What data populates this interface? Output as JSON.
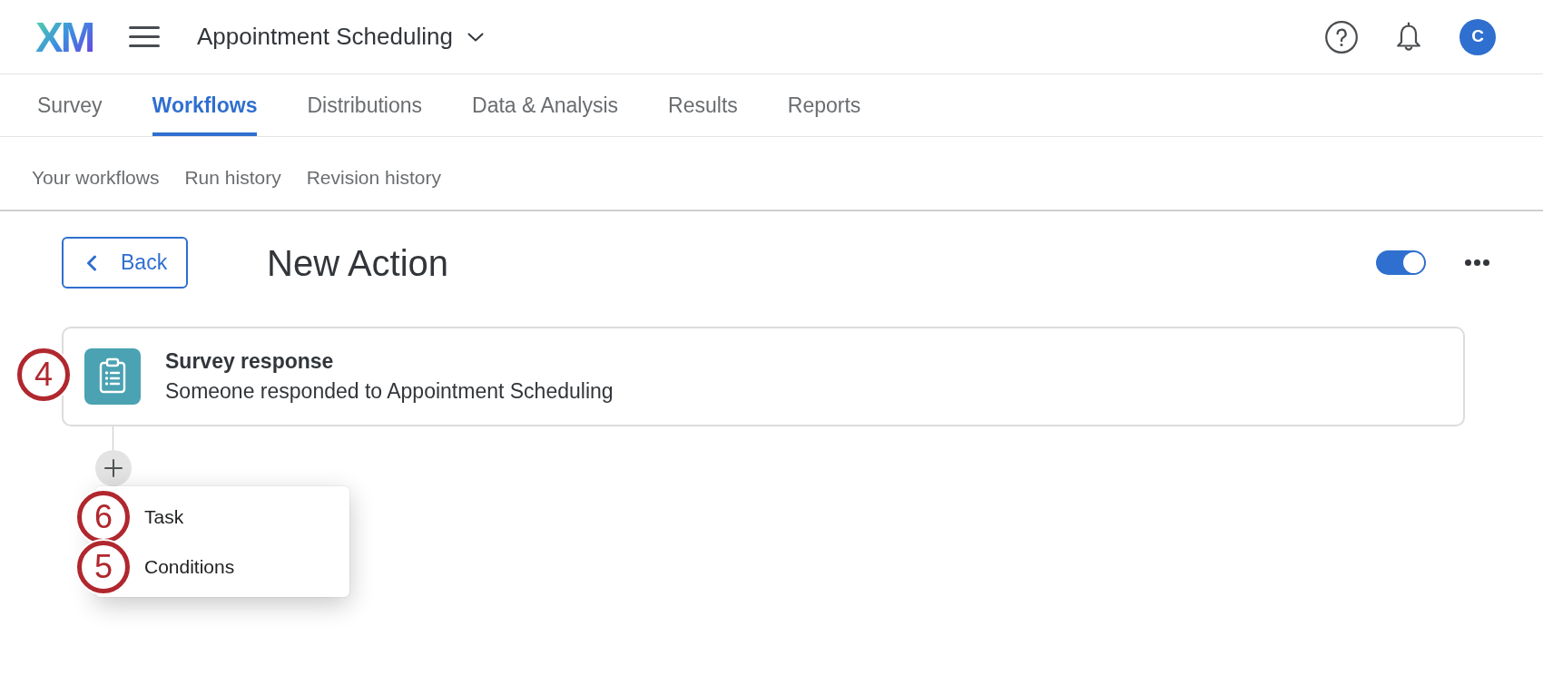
{
  "top_bar": {
    "logo": "XM",
    "project_title": "Appointment Scheduling",
    "avatar_initial": "C"
  },
  "tabs": [
    {
      "label": "Survey",
      "selected": false
    },
    {
      "label": "Workflows",
      "selected": true
    },
    {
      "label": "Distributions",
      "selected": false
    },
    {
      "label": "Data & Analysis",
      "selected": false
    },
    {
      "label": "Results",
      "selected": false
    },
    {
      "label": "Reports",
      "selected": false
    }
  ],
  "sub_nav": [
    "Your workflows",
    "Run history",
    "Revision history"
  ],
  "action_header": {
    "back_label": "Back",
    "title": "New Action",
    "on": true
  },
  "trigger_card": {
    "title": "Survey response",
    "description": "Someone responded to Appointment Scheduling",
    "callout": "4"
  },
  "add_menu": {
    "expanded": true,
    "items": [
      {
        "label": "Task",
        "callout": "6"
      },
      {
        "label": "Conditions",
        "callout": "5"
      }
    ]
  }
}
